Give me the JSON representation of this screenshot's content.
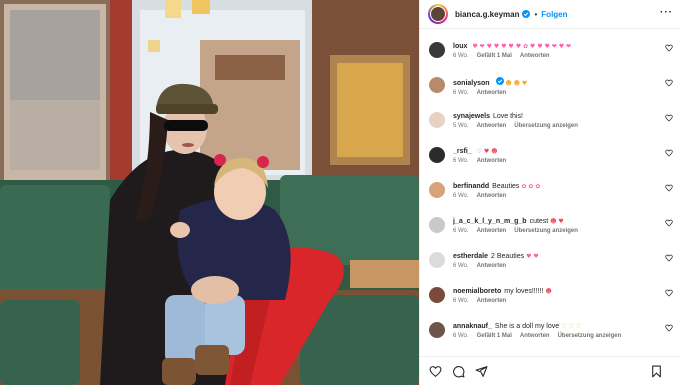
{
  "post": {
    "username": "bianca.g.keyman",
    "separator": "•",
    "follow_label": "Folgen",
    "more_label": "···",
    "photo_alt": "Mother and child on a bench at a cafe"
  },
  "comments": [
    {
      "user": "loux",
      "text": "",
      "emoji": "♥ ❤ ♥ ♥ ♥ ♥ ♥ ✿ ♥ ♥ ♥ ❤ ♥ ❤",
      "emoji_class": "emo-pink",
      "time": "6 Wo.",
      "likes": "Gefällt 1 Mal",
      "reply": "Antworten",
      "translate": "",
      "avatar_color": "#3a3a3a"
    },
    {
      "user": "sonialyson",
      "text": "",
      "emoji": "☻ ☻ ♥",
      "emoji_class": "emo-orange",
      "time": "6 Wo.",
      "likes": "",
      "reply": "Antworten",
      "translate": "",
      "avatar_color": "#b88c6a",
      "verified": true
    },
    {
      "user": "synajewels",
      "text": "Love this!",
      "emoji": "",
      "emoji_class": "",
      "time": "5 Wo.",
      "likes": "",
      "reply": "Antworten",
      "translate": "Übersetzung anzeigen",
      "avatar_color": "#e8d2c2"
    },
    {
      "user": "_rsfi_",
      "text": "",
      "emoji": "♡ ♥ ☻",
      "emoji_class": "emo-red",
      "time": "6 Wo.",
      "likes": "",
      "reply": "Antworten",
      "translate": "",
      "avatar_color": "#2b2b2b"
    },
    {
      "user": "berfinandd",
      "text": "Beauties",
      "emoji": "✿ ✿ ✿",
      "emoji_class": "emo-pink",
      "time": "6 Wo.",
      "likes": "",
      "reply": "Antworten",
      "translate": "",
      "avatar_color": "#d9a27a"
    },
    {
      "user": "j_a_c_k_l_y_n_m_g_b",
      "text": "cutest",
      "emoji": "☻ ♥",
      "emoji_class": "emo-red",
      "time": "6 Wo.",
      "likes": "",
      "reply": "Antworten",
      "translate": "Übersetzung anzeigen",
      "avatar_color": "#c9c9c9"
    },
    {
      "user": "estherdale",
      "text": "2 Beauties",
      "emoji": "♥ ♥",
      "emoji_class": "emo-pink",
      "time": "6 Wo.",
      "likes": "",
      "reply": "Antworten",
      "translate": "",
      "avatar_color": "#dbdbdb"
    },
    {
      "user": "noemialboreto",
      "text": "my loves!!!!!!",
      "emoji": "☻",
      "emoji_class": "emo-red",
      "time": "6 Wo.",
      "likes": "",
      "reply": "Antworten",
      "translate": "",
      "avatar_color": "#7a4a3a"
    },
    {
      "user": "annaknauf_",
      "text": "She is a doll my love",
      "emoji": "♡ ♡ ♡",
      "emoji_class": "emo-orange",
      "time": "6 Wo.",
      "likes": "Gefällt 1 Mal",
      "reply": "Antworten",
      "translate": "Übersetzung anzeigen",
      "avatar_color": "#6e5547"
    }
  ],
  "icons": {
    "like": "heart-icon",
    "comment": "comment-icon",
    "share": "share-icon",
    "save": "bookmark-icon",
    "verified": "verified-badge-icon"
  },
  "colors": {
    "accent": "#0095f6",
    "meta": "#737373",
    "border": "#efefef"
  }
}
